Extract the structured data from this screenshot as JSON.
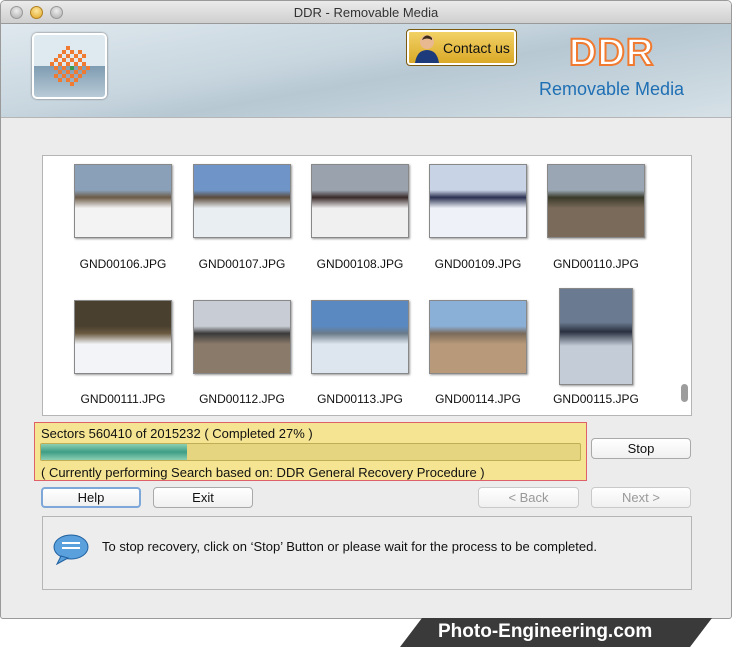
{
  "window": {
    "title": "DDR - Removable Media"
  },
  "header": {
    "contact_label": "Contact us",
    "brand": "DDR",
    "product": "Removable Media"
  },
  "gallery": {
    "items": [
      {
        "name": "GND00106.JPG",
        "colors": [
          "#8aa0b8",
          "#f3f3f3",
          "#6b5a45"
        ]
      },
      {
        "name": "GND00107.JPG",
        "colors": [
          "#6f95c8",
          "#e9eef2",
          "#5a4a3a"
        ]
      },
      {
        "name": "GND00108.JPG",
        "colors": [
          "#9aa3ad",
          "#f0f0f0",
          "#3a2a2a"
        ]
      },
      {
        "name": "GND00109.JPG",
        "colors": [
          "#c9d3e6",
          "#eef2f8",
          "#2a3050"
        ]
      },
      {
        "name": "GND00110.JPG",
        "colors": [
          "#9aa6b3",
          "#7a6a5a",
          "#3a3a2a"
        ]
      },
      {
        "name": "GND00111.JPG",
        "colors": [
          "#4a4030",
          "#f2f4f8",
          "#6a5a40"
        ]
      },
      {
        "name": "GND00112.JPG",
        "colors": [
          "#c8ccd4",
          "#8a7a6a",
          "#3a3a3a"
        ]
      },
      {
        "name": "GND00113.JPG",
        "colors": [
          "#5a88c0",
          "#dde6ee",
          "#6a7a88"
        ]
      },
      {
        "name": "GND00114.JPG",
        "colors": [
          "#8ab0d8",
          "#b89a7a",
          "#7a6a5a"
        ]
      },
      {
        "name": "GND00115.JPG",
        "colors": [
          "#6a7a90",
          "#c4ccd8",
          "#2a3040"
        ]
      }
    ]
  },
  "progress": {
    "sectors_text": "Sectors 560410 of 2015232   ( Completed 27% )",
    "percent": 27,
    "status_text": "( Currently performing Search based on: DDR General Recovery Procedure )"
  },
  "buttons": {
    "stop": "Stop",
    "help": "Help",
    "exit": "Exit",
    "back": "< Back",
    "next": "Next >"
  },
  "info": {
    "icon": "speech-bubble-icon",
    "message": "To stop recovery, click on ‘Stop’ Button or please wait for the process to be completed."
  },
  "footer": {
    "watermark": "Photo-Engineering.com"
  }
}
